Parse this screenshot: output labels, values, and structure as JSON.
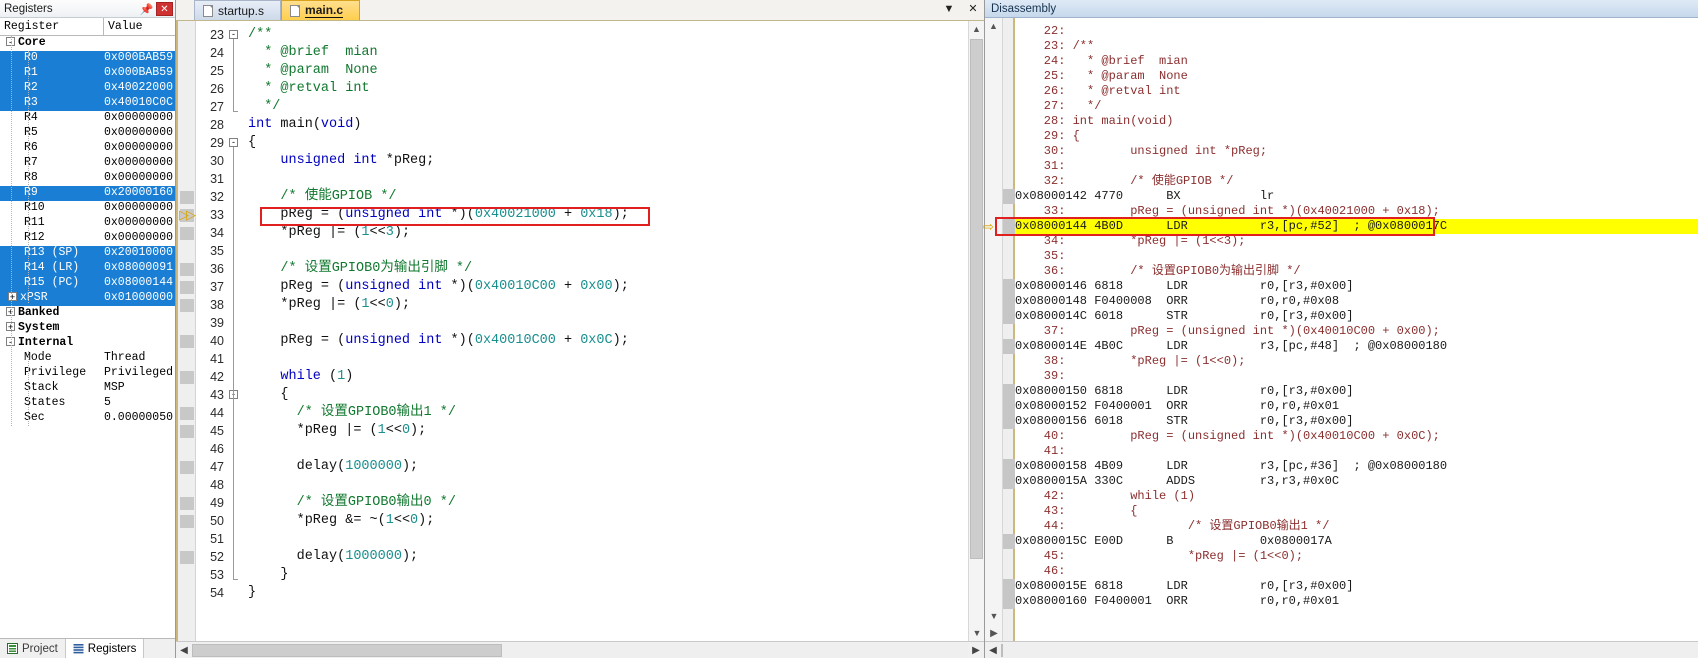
{
  "registers_pane": {
    "title": "Registers",
    "pin_icon": "pin-icon",
    "close_icon": "close-icon",
    "columns": [
      "Register",
      "Value"
    ],
    "rows": [
      {
        "indent": 0,
        "toggle": "-",
        "label": "Core",
        "value": "",
        "selected": false,
        "bold": true
      },
      {
        "indent": 1,
        "toggle": "",
        "label": "R0",
        "value": "0x000BAB59",
        "selected": true
      },
      {
        "indent": 1,
        "toggle": "",
        "label": "R1",
        "value": "0x000BAB59",
        "selected": true
      },
      {
        "indent": 1,
        "toggle": "",
        "label": "R2",
        "value": "0x40022000",
        "selected": true
      },
      {
        "indent": 1,
        "toggle": "",
        "label": "R3",
        "value": "0x40010C0C",
        "selected": true
      },
      {
        "indent": 1,
        "toggle": "",
        "label": "R4",
        "value": "0x00000000",
        "selected": false
      },
      {
        "indent": 1,
        "toggle": "",
        "label": "R5",
        "value": "0x00000000",
        "selected": false
      },
      {
        "indent": 1,
        "toggle": "",
        "label": "R6",
        "value": "0x00000000",
        "selected": false
      },
      {
        "indent": 1,
        "toggle": "",
        "label": "R7",
        "value": "0x00000000",
        "selected": false
      },
      {
        "indent": 1,
        "toggle": "",
        "label": "R8",
        "value": "0x00000000",
        "selected": false
      },
      {
        "indent": 1,
        "toggle": "",
        "label": "R9",
        "value": "0x20000160",
        "selected": true
      },
      {
        "indent": 1,
        "toggle": "",
        "label": "R10",
        "value": "0x00000000",
        "selected": false
      },
      {
        "indent": 1,
        "toggle": "",
        "label": "R11",
        "value": "0x00000000",
        "selected": false
      },
      {
        "indent": 1,
        "toggle": "",
        "label": "R12",
        "value": "0x00000000",
        "selected": false
      },
      {
        "indent": 1,
        "toggle": "",
        "label": "R13 (SP)",
        "value": "0x20010000",
        "selected": true
      },
      {
        "indent": 1,
        "toggle": "",
        "label": "R14 (LR)",
        "value": "0x08000091",
        "selected": true
      },
      {
        "indent": 1,
        "toggle": "",
        "label": "R15 (PC)",
        "value": "0x08000144",
        "selected": true
      },
      {
        "indent": 1,
        "toggle": "+",
        "label": "xPSR",
        "value": "0x01000000",
        "selected": true
      },
      {
        "indent": 0,
        "toggle": "+",
        "label": "Banked",
        "value": "",
        "selected": false,
        "bold": true
      },
      {
        "indent": 0,
        "toggle": "+",
        "label": "System",
        "value": "",
        "selected": false,
        "bold": true
      },
      {
        "indent": 0,
        "toggle": "-",
        "label": "Internal",
        "value": "",
        "selected": false,
        "bold": true
      },
      {
        "indent": 1,
        "toggle": "",
        "label": "Mode",
        "value": "Thread",
        "selected": false
      },
      {
        "indent": 1,
        "toggle": "",
        "label": "Privilege",
        "value": "Privileged",
        "selected": false
      },
      {
        "indent": 1,
        "toggle": "",
        "label": "Stack",
        "value": "MSP",
        "selected": false
      },
      {
        "indent": 1,
        "toggle": "",
        "label": "States",
        "value": "5",
        "selected": false
      },
      {
        "indent": 1,
        "toggle": "",
        "label": "Sec",
        "value": "0.00000050",
        "selected": false
      }
    ],
    "tabs": [
      {
        "label": "Project",
        "icon": "project-icon",
        "active": false
      },
      {
        "label": "Registers",
        "icon": "registers-icon",
        "active": true
      }
    ]
  },
  "editor_pane": {
    "tabs": [
      {
        "label": "startup.s",
        "icon": "file-icon",
        "active": false
      },
      {
        "label": "main.c",
        "icon": "file-icon",
        "active": true
      }
    ],
    "dropdown_icon": "chevron-down-icon",
    "close_icon": "close-icon",
    "first_line_number": 23,
    "lines": [
      {
        "n": 23,
        "fold": "-",
        "text": "/**",
        "cls": "cm",
        "bp": false
      },
      {
        "n": 24,
        "fold": "",
        "text": "  * @brief  mian",
        "cls": "cm",
        "bp": false
      },
      {
        "n": 25,
        "fold": "",
        "text": "  * @param  None",
        "cls": "cm",
        "bp": false
      },
      {
        "n": 26,
        "fold": "",
        "text": "  * @retval int",
        "cls": "cm",
        "bp": false
      },
      {
        "n": 27,
        "fold": "L",
        "text": "  */",
        "cls": "cm",
        "bp": false
      },
      {
        "n": 28,
        "fold": "",
        "text": "int main(void)",
        "cls": "kwline",
        "bp": false
      },
      {
        "n": 29,
        "fold": "-",
        "text": "{",
        "cls": "",
        "bp": false
      },
      {
        "n": 30,
        "fold": "",
        "text": "    unsigned int *pReg;",
        "cls": "kwline",
        "bp": false
      },
      {
        "n": 31,
        "fold": "",
        "text": "",
        "cls": "",
        "bp": false
      },
      {
        "n": 32,
        "fold": "",
        "text": "    /* 使能GPIOB */",
        "cls": "cm",
        "bp": true
      },
      {
        "n": 33,
        "fold": "",
        "text": "    pReg = (unsigned int *)(0x40021000 + 0x18);",
        "cls": "mix",
        "bp": true,
        "current": true,
        "highlight": true
      },
      {
        "n": 34,
        "fold": "",
        "text": "    *pReg |= (1<<3);",
        "cls": "mix",
        "bp": true
      },
      {
        "n": 35,
        "fold": "",
        "text": "",
        "cls": "",
        "bp": false
      },
      {
        "n": 36,
        "fold": "",
        "text": "    /* 设置GPIOB0为输出引脚 */",
        "cls": "cm",
        "bp": true
      },
      {
        "n": 37,
        "fold": "",
        "text": "    pReg = (unsigned int *)(0x40010C00 + 0x00);",
        "cls": "mix",
        "bp": true
      },
      {
        "n": 38,
        "fold": "",
        "text": "    *pReg |= (1<<0);",
        "cls": "mix",
        "bp": true
      },
      {
        "n": 39,
        "fold": "",
        "text": "",
        "cls": "",
        "bp": false
      },
      {
        "n": 40,
        "fold": "",
        "text": "    pReg = (unsigned int *)(0x40010C00 + 0x0C);",
        "cls": "mix",
        "bp": true
      },
      {
        "n": 41,
        "fold": "",
        "text": "",
        "cls": "",
        "bp": false
      },
      {
        "n": 42,
        "fold": "",
        "text": "    while (1)",
        "cls": "kwline",
        "bp": true
      },
      {
        "n": 43,
        "fold": "-",
        "text": "    {",
        "cls": "",
        "bp": false
      },
      {
        "n": 44,
        "fold": "",
        "text": "      /* 设置GPIOB0输出1 */",
        "cls": "cm",
        "bp": true
      },
      {
        "n": 45,
        "fold": "",
        "text": "      *pReg |= (1<<0);",
        "cls": "mix",
        "bp": true
      },
      {
        "n": 46,
        "fold": "",
        "text": "",
        "cls": "",
        "bp": false
      },
      {
        "n": 47,
        "fold": "",
        "text": "      delay(1000000);",
        "cls": "mix",
        "bp": true
      },
      {
        "n": 48,
        "fold": "",
        "text": "",
        "cls": "",
        "bp": false
      },
      {
        "n": 49,
        "fold": "",
        "text": "      /* 设置GPIOB0输出0 */",
        "cls": "cm",
        "bp": true
      },
      {
        "n": 50,
        "fold": "",
        "text": "      *pReg &= ~(1<<0);",
        "cls": "mix",
        "bp": true
      },
      {
        "n": 51,
        "fold": "",
        "text": "",
        "cls": "",
        "bp": false
      },
      {
        "n": 52,
        "fold": "",
        "text": "      delay(1000000);",
        "cls": "mix",
        "bp": true
      },
      {
        "n": 53,
        "fold": "L",
        "text": "    }",
        "cls": "",
        "bp": false
      },
      {
        "n": 54,
        "fold": "",
        "text": "}",
        "cls": "",
        "bp": false
      }
    ],
    "hscroll_left_icon": "chevron-left-icon",
    "hscroll_right_icon": "chevron-right-icon",
    "vscroll_up_icon": "chevron-up-icon",
    "vscroll_down_icon": "chevron-down-icon"
  },
  "disassembly_pane": {
    "title": "Disassembly",
    "lines": [
      {
        "type": "src",
        "text": "    22:"
      },
      {
        "type": "src",
        "text": "    23: /**"
      },
      {
        "type": "src",
        "text": "    24:   * @brief  mian"
      },
      {
        "type": "src",
        "text": "    25:   * @param  None"
      },
      {
        "type": "src",
        "text": "    26:   * @retval int"
      },
      {
        "type": "src",
        "text": "    27:   */"
      },
      {
        "type": "src",
        "text": "    28: int main(void)"
      },
      {
        "type": "src",
        "text": "    29: {"
      },
      {
        "type": "src",
        "text": "    30:         unsigned int *pReg;"
      },
      {
        "type": "src",
        "text": "    31:"
      },
      {
        "type": "src",
        "text": "    32:         /* 使能GPIOB */"
      },
      {
        "type": "asm",
        "text": "0x08000142 4770      BX           lr",
        "mark": true
      },
      {
        "type": "src",
        "text": "    33:         pReg = (unsigned int *)(0x40021000 + 0x18);"
      },
      {
        "type": "asm",
        "text": "0x08000144 4B0D      LDR          r3,[pc,#52]  ; @0x0800017C",
        "current": true,
        "highlight": true
      },
      {
        "type": "src",
        "text": "    34:         *pReg |= (1<<3);"
      },
      {
        "type": "src",
        "text": "    35:"
      },
      {
        "type": "src",
        "text": "    36:         /* 设置GPIOB0为输出引脚 */"
      },
      {
        "type": "asm",
        "text": "0x08000146 6818      LDR          r0,[r3,#0x00]",
        "mark": true
      },
      {
        "type": "asm",
        "text": "0x08000148 F0400008  ORR          r0,r0,#0x08",
        "mark": true
      },
      {
        "type": "asm",
        "text": "0x0800014C 6018      STR          r0,[r3,#0x00]",
        "mark": true
      },
      {
        "type": "src",
        "text": "    37:         pReg = (unsigned int *)(0x40010C00 + 0x00);"
      },
      {
        "type": "asm",
        "text": "0x0800014E 4B0C      LDR          r3,[pc,#48]  ; @0x08000180",
        "mark": true
      },
      {
        "type": "src",
        "text": "    38:         *pReg |= (1<<0);"
      },
      {
        "type": "src",
        "text": "    39:"
      },
      {
        "type": "asm",
        "text": "0x08000150 6818      LDR          r0,[r3,#0x00]",
        "mark": true
      },
      {
        "type": "asm",
        "text": "0x08000152 F0400001  ORR          r0,r0,#0x01",
        "mark": true
      },
      {
        "type": "asm",
        "text": "0x08000156 6018      STR          r0,[r3,#0x00]",
        "mark": true
      },
      {
        "type": "src",
        "text": "    40:         pReg = (unsigned int *)(0x40010C00 + 0x0C);"
      },
      {
        "type": "src",
        "text": "    41:"
      },
      {
        "type": "asm",
        "text": "0x08000158 4B09      LDR          r3,[pc,#36]  ; @0x08000180",
        "mark": true
      },
      {
        "type": "asm",
        "text": "0x0800015A 330C      ADDS         r3,r3,#0x0C",
        "mark": true
      },
      {
        "type": "src",
        "text": "    42:         while (1)"
      },
      {
        "type": "src",
        "text": "    43:         {"
      },
      {
        "type": "src",
        "text": "    44:                 /* 设置GPIOB0输出1 */"
      },
      {
        "type": "asm",
        "text": "0x0800015C E00D      B            0x0800017A",
        "mark": true
      },
      {
        "type": "src",
        "text": "    45:                 *pReg |= (1<<0);"
      },
      {
        "type": "src",
        "text": "    46:"
      },
      {
        "type": "asm",
        "text": "0x0800015E 6818      LDR          r0,[r3,#0x00]",
        "mark": true
      },
      {
        "type": "asm",
        "text": "0x08000160 F0400001  ORR          r0,r0,#0x01",
        "mark": true
      }
    ],
    "scroll_up_icon": "chevron-up-icon",
    "scroll_down_icon": "chevron-down-icon",
    "hscroll_left_icon": "chevron-left-icon",
    "hscroll_right_icon": "chevron-right-icon"
  },
  "colors": {
    "selection_blue": "#1a7fd4",
    "highlight_yellow": "#ffff00",
    "highlight_red_border": "#e01f1f",
    "active_tab_orange": "#ffcf4e",
    "comment_green": "#11782f",
    "keyword_blue": "#0000c0",
    "number_teal": "#1a8f8f",
    "disasm_source_red": "#8b2f2f"
  }
}
